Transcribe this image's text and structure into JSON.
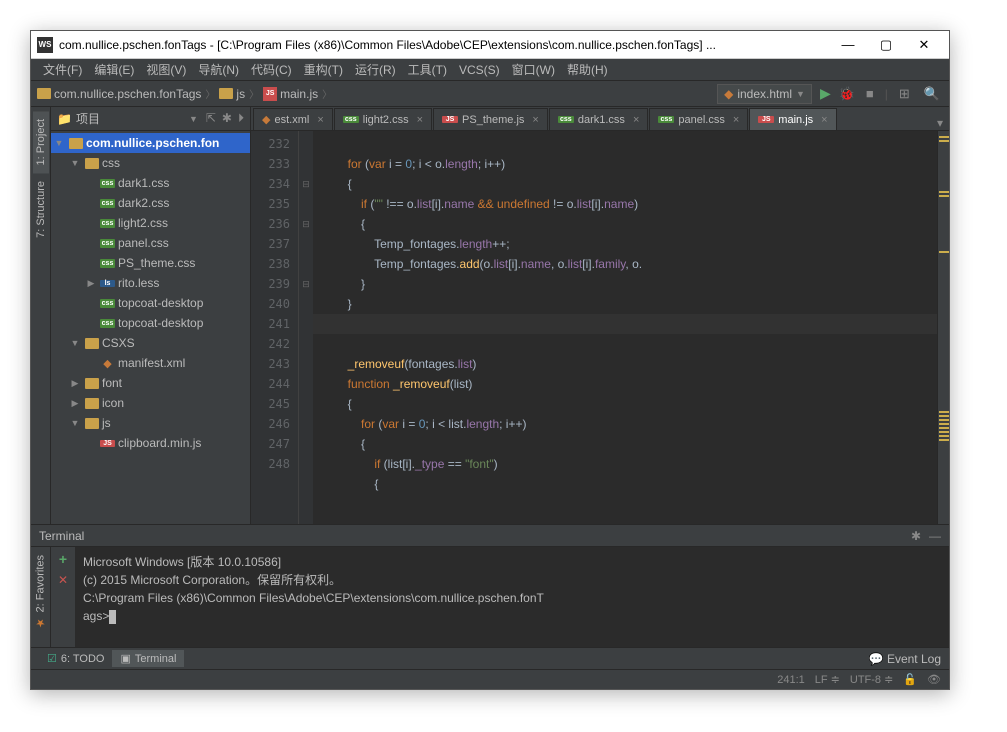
{
  "title": "com.nullice.pschen.fonTags - [C:\\Program Files (x86)\\Common Files\\Adobe\\CEP\\extensions\\com.nullice.pschen.fonTags] ...",
  "menu": [
    "文件(F)",
    "编辑(E)",
    "视图(V)",
    "导航(N)",
    "代码(C)",
    "重构(T)",
    "运行(R)",
    "工具(T)",
    "VCS(S)",
    "窗口(W)",
    "帮助(H)"
  ],
  "breadcrumb": {
    "root": "com.nullice.pschen.fonTags",
    "folder": "js",
    "file": "main.js"
  },
  "nav_dropdown": "index.html",
  "sidebar_title": "项目",
  "left_tabs": [
    "1: Project",
    "7: Structure"
  ],
  "fav_tab": "2: Favorites",
  "tree": {
    "root": "com.nullice.pschen.fon",
    "css_folder": "css",
    "css_files": [
      "dark1.css",
      "dark2.css",
      "light2.css",
      "panel.css",
      "PS_theme.css"
    ],
    "less_file": "rito.less",
    "topcoat1": "topcoat-desktop",
    "topcoat2": "topcoat-desktop",
    "csxs": "CSXS",
    "manifest": "manifest.xml",
    "font": "font",
    "icon": "icon",
    "js": "js",
    "clipboard": "clipboard.min.js"
  },
  "tabs": [
    {
      "icon": "xml",
      "name": "est.xml",
      "active": false
    },
    {
      "icon": "css",
      "name": "light2.css",
      "active": false
    },
    {
      "icon": "js",
      "name": "PS_theme.js",
      "active": false
    },
    {
      "icon": "css",
      "name": "dark1.css",
      "active": false
    },
    {
      "icon": "css",
      "name": "panel.css",
      "active": false
    },
    {
      "icon": "js",
      "name": "main.js",
      "active": true
    }
  ],
  "line_start": 232,
  "line_end": 248,
  "terminal_title": "Terminal",
  "terminal_lines": [
    "Microsoft Windows [版本 10.0.10586]",
    "(c) 2015 Microsoft Corporation。保留所有权利。",
    "",
    "C:\\Program Files (x86)\\Common Files\\Adobe\\CEP\\extensions\\com.nullice.pschen.fonT",
    "ags>"
  ],
  "bottom_tabs": {
    "todo": "6: TODO",
    "terminal": "Terminal"
  },
  "event_log": "Event Log",
  "status": {
    "pos": "241:1",
    "lf": "LF",
    "enc": "UTF-8"
  }
}
